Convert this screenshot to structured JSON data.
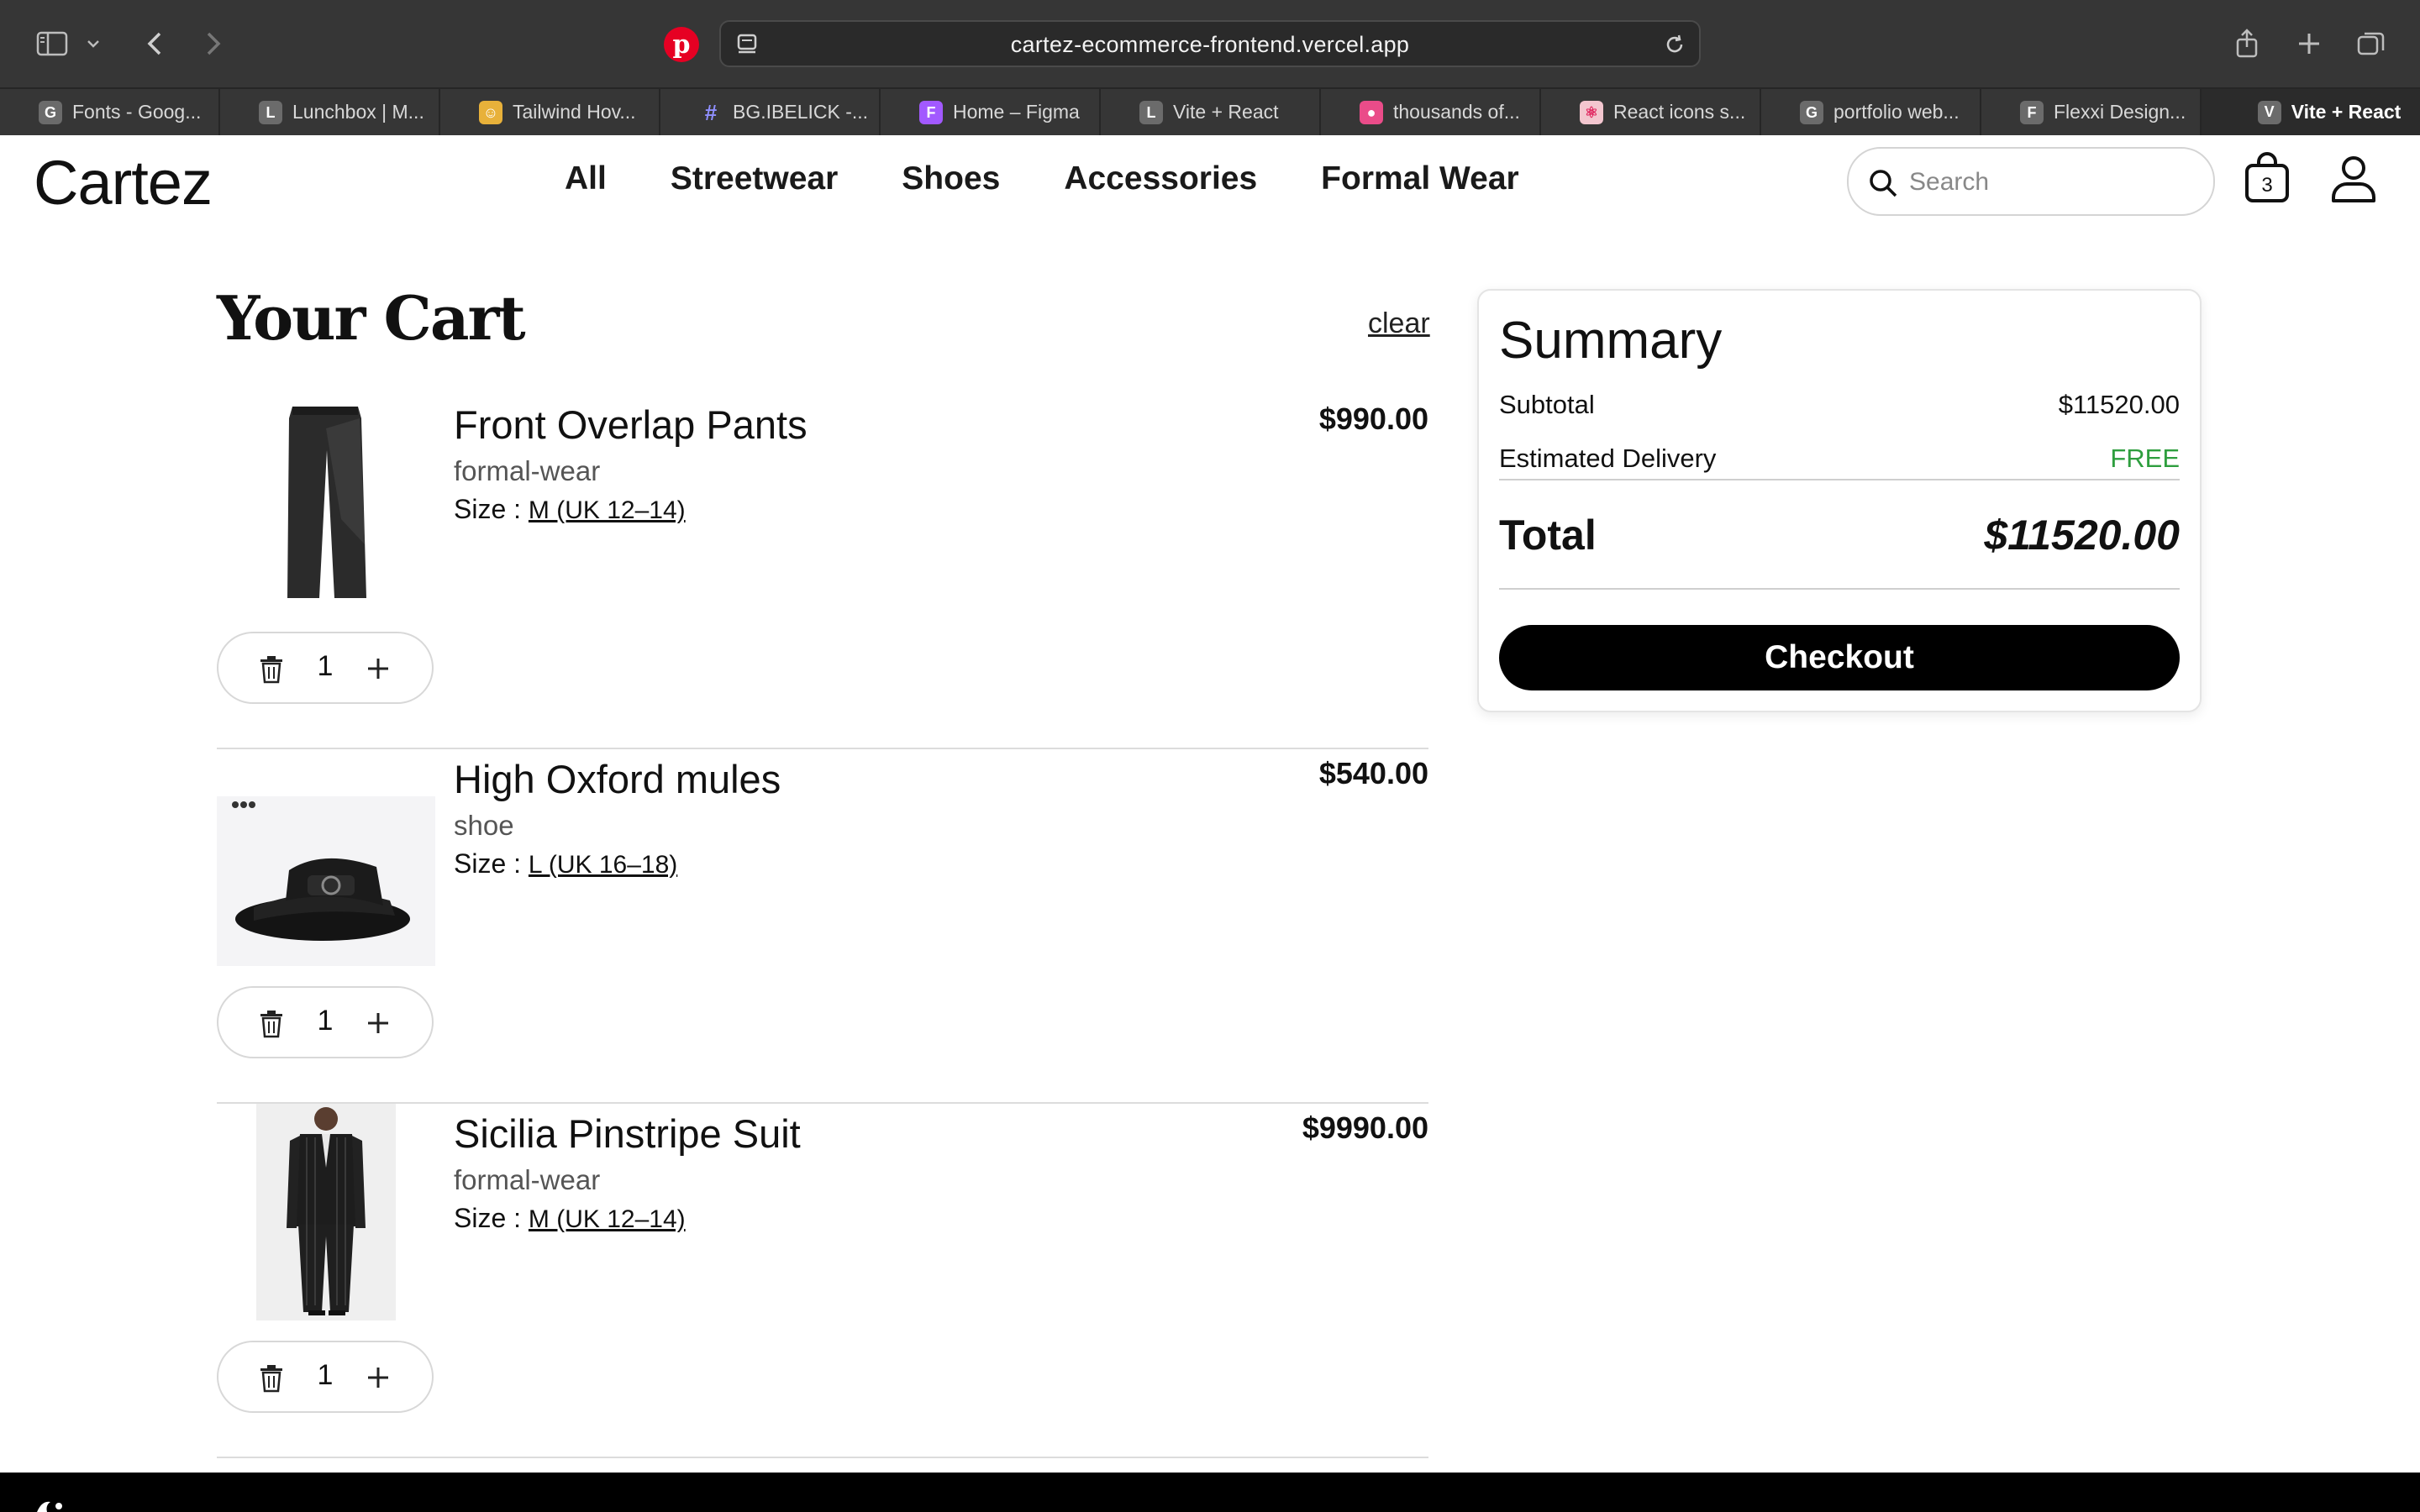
{
  "browser": {
    "url": "cartez-ecommerce-frontend.vercel.app",
    "tabs": [
      {
        "favicon": "G",
        "label": "Fonts - Goog..."
      },
      {
        "favicon": "L",
        "label": "Lunchbox | M..."
      },
      {
        "favicon": "☺",
        "label": "Tailwind Hov..."
      },
      {
        "favicon": "#",
        "label": "BG.IBELICK -..."
      },
      {
        "favicon": "F",
        "label": "Home – Figma"
      },
      {
        "favicon": "L",
        "label": "Vite + React"
      },
      {
        "favicon": "●",
        "label": "thousands of..."
      },
      {
        "favicon": "⚛",
        "label": "React icons s..."
      },
      {
        "favicon": "G",
        "label": "portfolio web..."
      },
      {
        "favicon": "F",
        "label": "Flexxi Design..."
      }
    ],
    "active_tab": {
      "favicon": "V",
      "label": "Vite + React"
    }
  },
  "header": {
    "logo": "Cartez",
    "nav": [
      "All",
      "Streetwear",
      "Shoes",
      "Accessories",
      "Formal Wear"
    ],
    "search_placeholder": "Search",
    "cart_count": "3"
  },
  "cart": {
    "title": "Your Cart",
    "clear_label": "clear",
    "size_label": "Size : ",
    "items": [
      {
        "name": "Front Overlap Pants",
        "category": "formal-wear",
        "size": "M (UK 12–14)",
        "price": "$990.00",
        "quantity": "1",
        "image": "pants-image"
      },
      {
        "name": "High Oxford mules",
        "category": "shoe",
        "size": "L (UK 16–18)",
        "price": "$540.00",
        "quantity": "1",
        "image": "mules-image"
      },
      {
        "name": "Sicilia Pinstripe Suit",
        "category": "formal-wear",
        "size": "M (UK 12–14)",
        "price": "$9990.00",
        "quantity": "1",
        "image": "suit-image"
      }
    ]
  },
  "summary": {
    "title": "Summary",
    "subtotal_label": "Subtotal",
    "subtotal_value": "$11520.00",
    "delivery_label": "Estimated Delivery",
    "delivery_value": "FREE",
    "total_label": "Total",
    "total_value": "$11520.00",
    "checkout_label": "Checkout"
  },
  "colors": {
    "chrome_bg": "#363636",
    "free_green": "#2e9e3e",
    "checkout_bg": "#000000",
    "footer_bg": "#000000"
  }
}
